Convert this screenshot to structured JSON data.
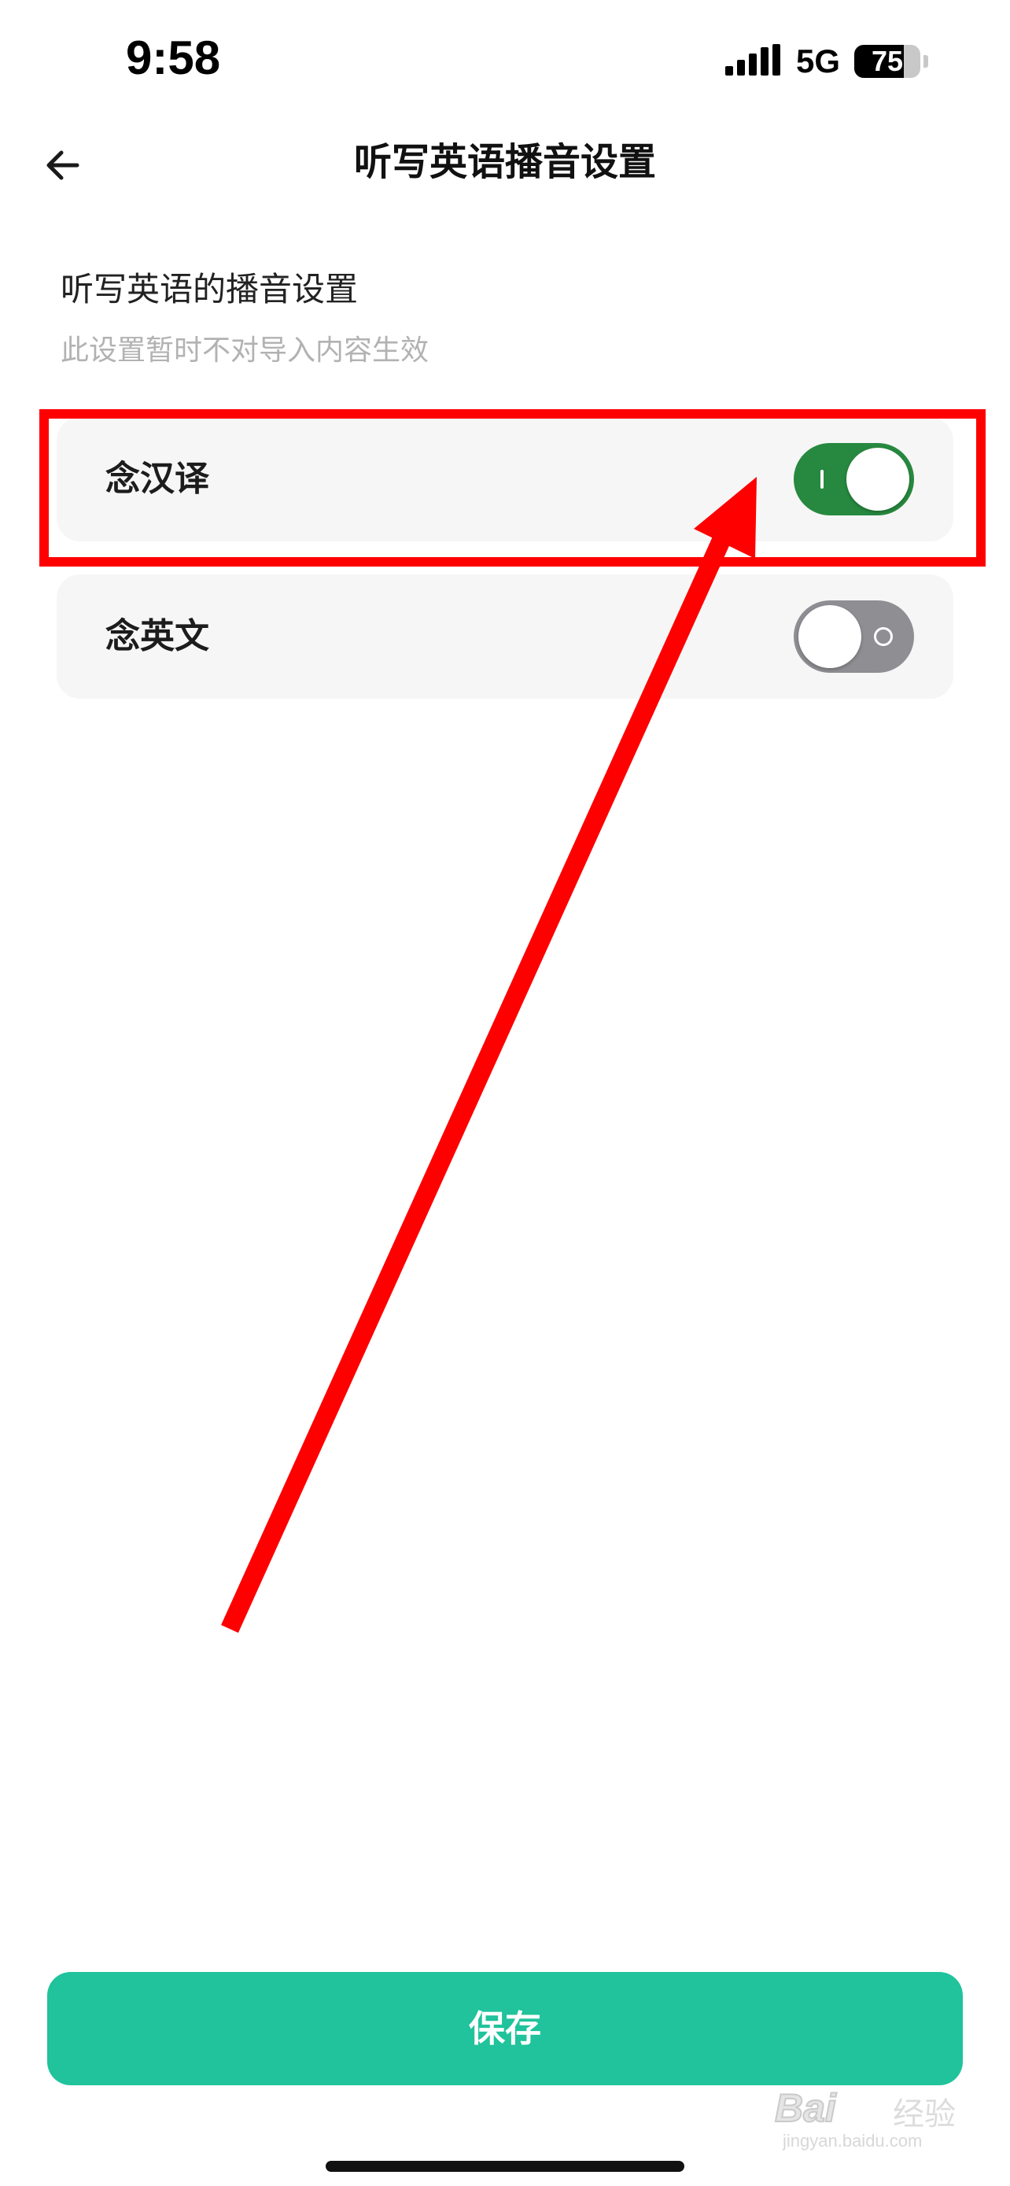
{
  "status_bar": {
    "time": "9:58",
    "network": "5G",
    "battery": "75",
    "battery_level": 0.75,
    "signal_icon": "cellular-signal-icon",
    "battery_icon": "battery-icon"
  },
  "header": {
    "title": "听写英语播音设置",
    "back_icon": "arrow-left-icon"
  },
  "section": {
    "title": "听写英语的播音设置",
    "subtitle": "此设置暂时不对导入内容生效"
  },
  "settings": [
    {
      "label": "念汉译",
      "enabled": true
    },
    {
      "label": "念英文",
      "enabled": false
    }
  ],
  "save_button": {
    "label": "保存"
  },
  "watermark": {
    "brand": "Bai",
    "sub": "经验",
    "domain": "jingyan.baidu.com"
  },
  "colors": {
    "primary": "#20c39b",
    "toggle_on": "#27893f",
    "toggle_off": "#8e8e93",
    "card_bg": "#f6f6f6",
    "annotation": "#fe0000",
    "subtitle_text": "#b2b2b2"
  }
}
